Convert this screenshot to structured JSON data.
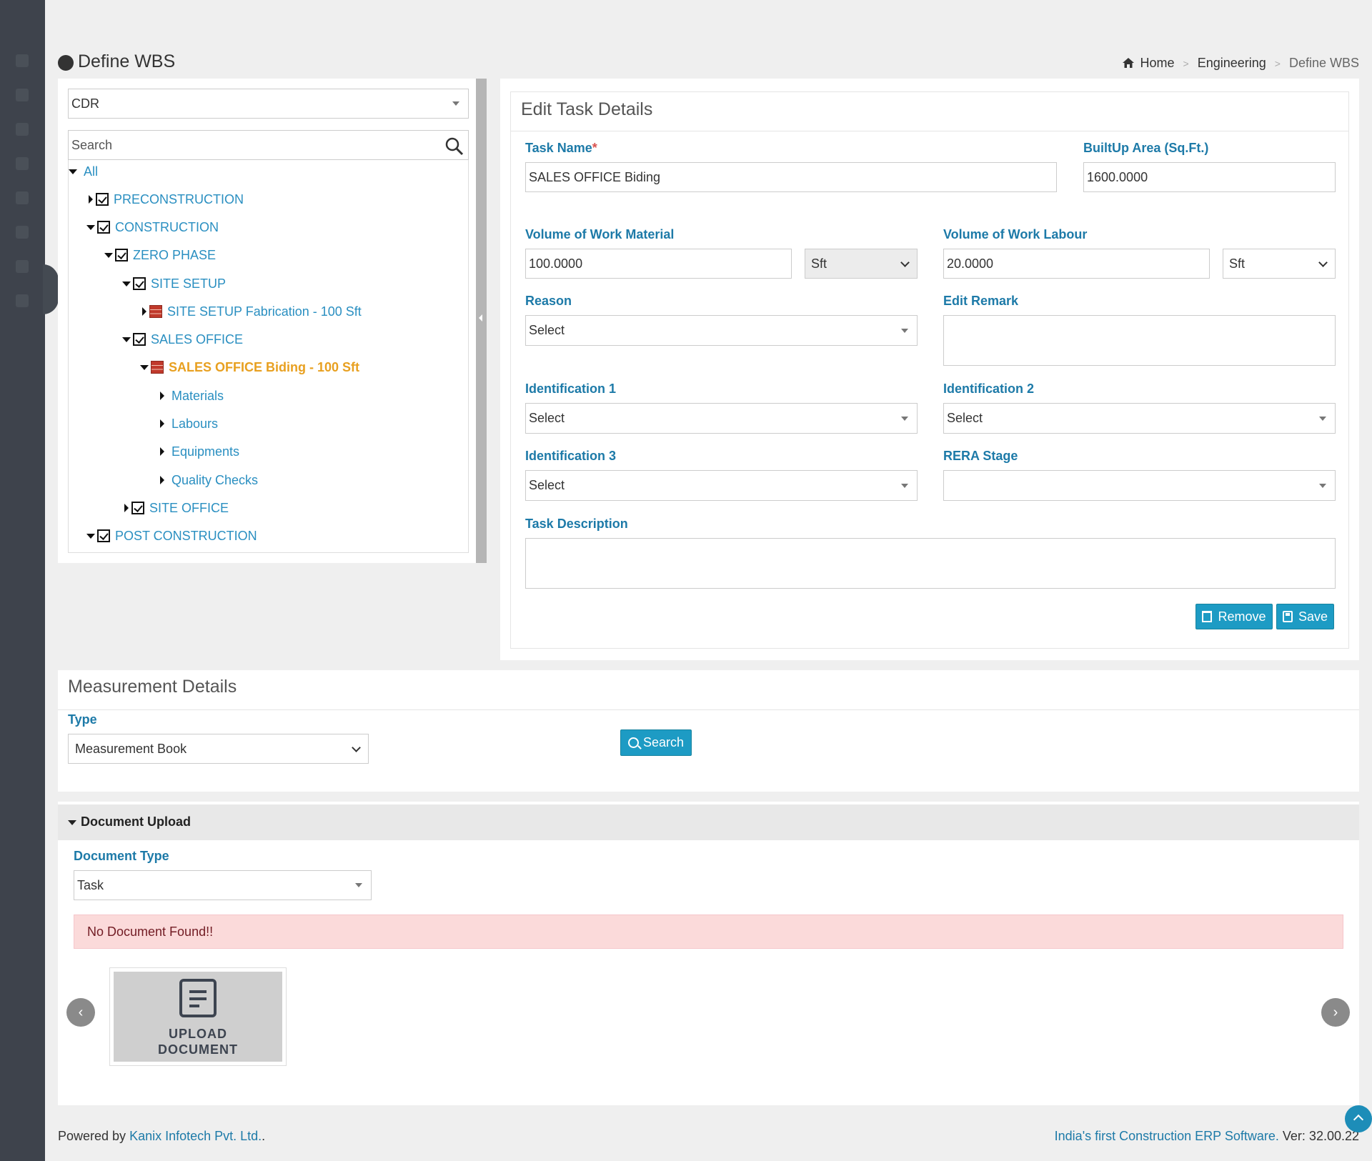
{
  "header": {
    "title": "Define WBS",
    "breadcrumb": [
      "Home",
      "Engineering",
      "Define WBS"
    ]
  },
  "tree": {
    "project_select": "CDR",
    "search_placeholder": "Search",
    "nodes": [
      {
        "label": "All"
      },
      {
        "label": "PRECONSTRUCTION"
      },
      {
        "label": "CONSTRUCTION"
      },
      {
        "label": "ZERO PHASE"
      },
      {
        "label": "SITE SETUP"
      },
      {
        "label": "SITE SETUP Fabrication - 100 Sft"
      },
      {
        "label": "SALES OFFICE"
      },
      {
        "label": "SALES OFFICE Biding - 100 Sft"
      },
      {
        "label": "Materials"
      },
      {
        "label": "Labours"
      },
      {
        "label": "Equipments"
      },
      {
        "label": "Quality Checks"
      },
      {
        "label": "SITE OFFICE"
      },
      {
        "label": "POST CONSTRUCTION"
      }
    ]
  },
  "edit": {
    "title": "Edit Task Details",
    "task_name_label": "Task Name",
    "task_name_required": "*",
    "task_name_value": "SALES OFFICE Biding",
    "builtup_label": "BuiltUp Area (Sq.Ft.)",
    "builtup_value": "1600.0000",
    "vol_material_label": "Volume of Work Material",
    "vol_material_value": "100.0000",
    "vol_material_unit": "Sft",
    "vol_labour_label": "Volume of Work Labour",
    "vol_labour_value": "20.0000",
    "vol_labour_unit": "Sft",
    "reason_label": "Reason",
    "reason_value": "Select",
    "edit_remark_label": "Edit Remark",
    "edit_remark_value": "",
    "ident1_label": "Identification 1",
    "ident1_value": "Select",
    "ident2_label": "Identification 2",
    "ident2_value": "Select",
    "ident3_label": "Identification 3",
    "ident3_value": "Select",
    "rera_label": "RERA Stage",
    "rera_value": "",
    "desc_label": "Task Description",
    "desc_value": "",
    "remove_label": "Remove",
    "save_label": "Save"
  },
  "measurement": {
    "title": "Measurement Details",
    "type_label": "Type",
    "type_value": "Measurement Book",
    "search_label": "Search"
  },
  "documents": {
    "header": "Document Upload",
    "type_label": "Document Type",
    "type_value": "Task",
    "alert": "No Document Found!!",
    "prev": "‹",
    "next": "›",
    "upload_line1": "UPLOAD",
    "upload_line2": "DOCUMENT"
  },
  "footer": {
    "powered_prefix": "Powered by ",
    "company": "Kanix Infotech Pvt. Ltd.",
    "company_suffix": ".",
    "tagline": "India's first Construction ERP Software.",
    "version": " Ver: 32.00.22"
  },
  "colors": {
    "accent": "#1d9bc4",
    "label": "#1d7aa8",
    "tree_link": "#2a8fc1",
    "selected_node": "#e8a020",
    "sidebar": "#3e434c"
  }
}
